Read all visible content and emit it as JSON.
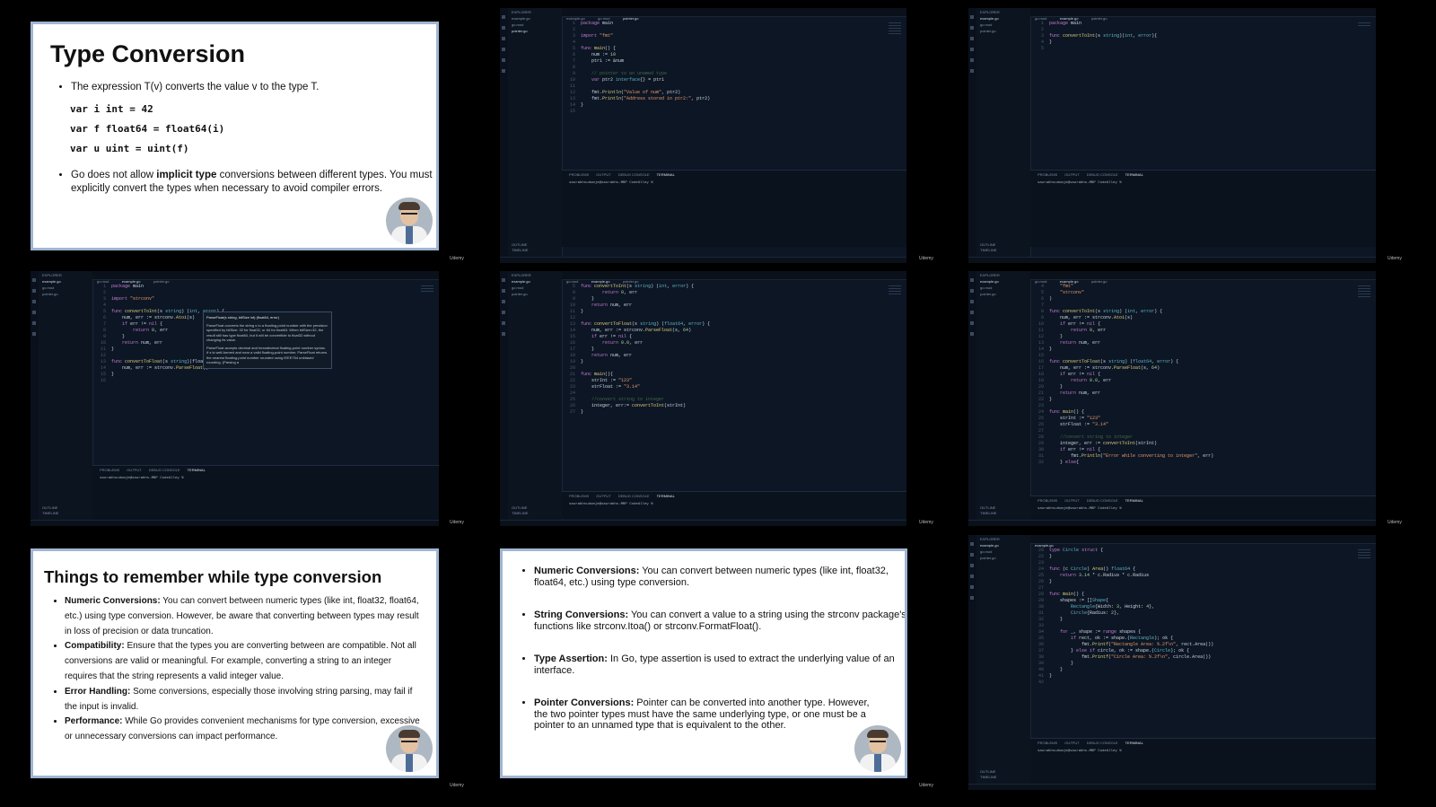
{
  "watermark": "Udemy",
  "slide1": {
    "title": "Type Conversion",
    "bullet1": "The expression T(v) converts the value v to the type T.",
    "code": [
      "var i int = 42",
      "var f float64 = float64(i)",
      "var u uint = uint(f)"
    ],
    "bullet2_pre": "Go does not allow ",
    "bullet2_bold": "implicit type",
    "bullet2_post": " conversions between different types. You must explicitly convert the types when necessary to avoid compiler errors."
  },
  "slide2": {
    "title": "Things to remember while type conversion",
    "items": [
      {
        "head": "Numeric Conversions:",
        "text": " You can convert between numeric types (like int, float32, float64, etc.) using type conversion. However, be aware that converting between types may result in loss of precision or data truncation."
      },
      {
        "head": "Compatibility:",
        "text": " Ensure that the types you are converting between are compatible. Not all conversions are valid or meaningful. For example, converting a string to an integer requires that the string represents a valid integer value."
      },
      {
        "head": "Error Handling:",
        "text": " Some conversions, especially those involving string parsing, may fail if the input is invalid."
      },
      {
        "head": "Performance:",
        "text": " While Go provides convenient mechanisms for type conversion, excessive or unnecessary conversions can impact performance."
      }
    ]
  },
  "slide3": {
    "items": [
      {
        "head": "Numeric Conversions:",
        "text": " You can convert between numeric types (like int, float32, float64, etc.) using type conversion."
      },
      {
        "head": "String Conversions:",
        "text": " You can convert a value to a string using the strconv package's functions like strconv.Itoa() or strconv.FormatFloat()."
      },
      {
        "head": "Type Assertion:",
        "text": " In Go, type assertion is used to extract the underlying value of an interface."
      },
      {
        "head": "Pointer Conversions:",
        "text": " Pointer can be converted into another type. However, the two pointer types must have the same underlying type, or one must be a pointer to an unnamed type that is equivalent to the other."
      }
    ]
  },
  "editor": {
    "explorer": "EXPLORER",
    "files": [
      "example.go",
      "go.mod",
      "pointer.go"
    ],
    "outline": "OUTLINE",
    "timeline": "TIMELINE",
    "panel_tabs": [
      "PROBLEMS",
      "OUTPUT",
      "DEBUG CONSOLE",
      "TERMINAL"
    ],
    "prompt": "saurabhsudumje@saurabhs-MBP CodeAlley %"
  },
  "tooltip": {
    "sig": "ParseFloat(s string, bitSize int) (float64, error)",
    "p1": "ParseFloat converts the string s to a floating-point number with the precision specified by bitSize: 32 for float32, or 64 for float64. When bitSize=32, the result still has type float64, but it will be convertible to float32 without changing its value.",
    "p2": "ParseFloat accepts decimal and hexadecimal floating-point number syntax. If s is well-formed and near a valid floating-point number, ParseFloat returns the nearest floating-point number rounded using IEEE754 unbiased rounding. (Parsing a"
  }
}
